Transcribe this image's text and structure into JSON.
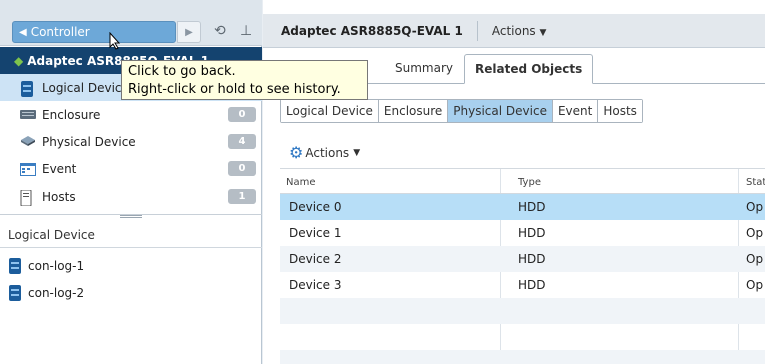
{
  "nav": {
    "back_label": "Controller",
    "object_title": "Adaptec ASR8885Q-EVAL 1",
    "items": [
      {
        "label": "Logical Device",
        "count": ""
      },
      {
        "label": "Enclosure",
        "count": "0"
      },
      {
        "label": "Physical Device",
        "count": "4"
      },
      {
        "label": "Event",
        "count": "0"
      },
      {
        "label": "Hosts",
        "count": "1"
      }
    ]
  },
  "tooltip": {
    "line1": "Click to go back.",
    "line2": "Right-click or hold to see history."
  },
  "left_lower": {
    "header": "Logical Device",
    "items": [
      "con-log-1",
      "con-log-2"
    ]
  },
  "header": {
    "title": "Adaptec ASR8885Q-EVAL 1",
    "actions_label": "Actions"
  },
  "tabs": [
    "d",
    "Summary",
    "Related Objects"
  ],
  "subtabs": [
    "Logical Device",
    "Enclosure",
    "Physical Device",
    "Event",
    "Hosts"
  ],
  "sub_actions_label": "Actions",
  "table": {
    "columns": [
      "Name",
      "Type",
      "Stat"
    ],
    "rows": [
      {
        "name": "Device 0",
        "type": "HDD",
        "status": "Op"
      },
      {
        "name": "Device 1",
        "type": "HDD",
        "status": "Op"
      },
      {
        "name": "Device 2",
        "type": "HDD",
        "status": "Op"
      },
      {
        "name": "Device 3",
        "type": "HDD",
        "status": "Op"
      }
    ]
  },
  "colors": {
    "header_dark": "#14436f",
    "selected_row": "#b7def7",
    "active_segment": "#a8d0ee",
    "back_button": "#6da8d8",
    "tooltip_bg": "#ffffe1"
  }
}
